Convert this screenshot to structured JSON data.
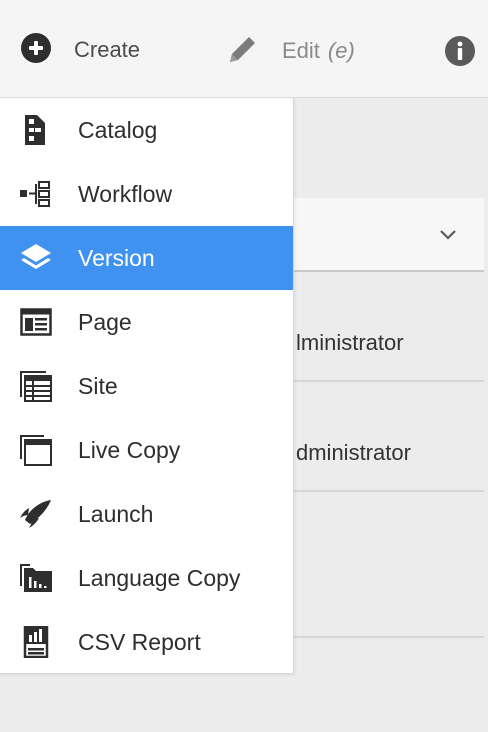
{
  "toolbar": {
    "create_label": "Create",
    "edit_label": "Edit",
    "edit_shortcut": "(e)",
    "icons": [
      "plus-circle-icon",
      "pencil-icon",
      "info-icon"
    ]
  },
  "background": {
    "rows": [
      {
        "text": "lministrator"
      },
      {
        "text": "dministrator"
      }
    ]
  },
  "menu": {
    "items": [
      {
        "label": "Catalog",
        "icon": "catalog-icon"
      },
      {
        "label": "Workflow",
        "icon": "workflow-icon"
      },
      {
        "label": "Version",
        "icon": "layers-icon",
        "selected": true
      },
      {
        "label": "Page",
        "icon": "page-icon"
      },
      {
        "label": "Site",
        "icon": "site-icon"
      },
      {
        "label": "Live Copy",
        "icon": "live-copy-icon"
      },
      {
        "label": "Launch",
        "icon": "launch-icon"
      },
      {
        "label": "Language Copy",
        "icon": "language-copy-icon"
      },
      {
        "label": "CSV Report",
        "icon": "csv-report-icon"
      }
    ]
  },
  "colors": {
    "selected_background": "#3f92f0",
    "icon": "#2e2e2e",
    "toolbar_background": "#f5f5f5"
  }
}
